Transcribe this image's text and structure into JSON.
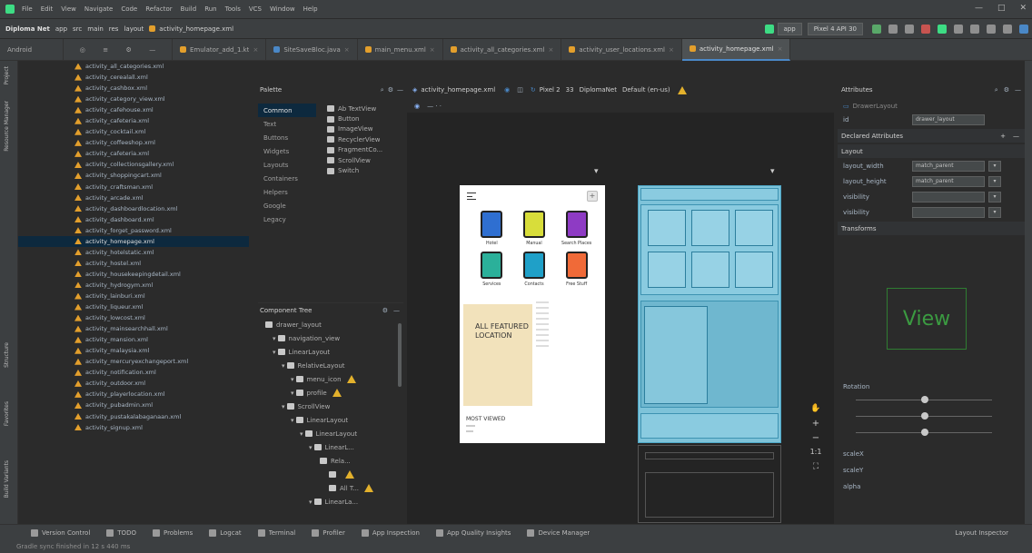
{
  "menu": {
    "items": [
      "File",
      "Edit",
      "View",
      "Navigate",
      "Code",
      "Refactor",
      "Build",
      "Run",
      "Tools",
      "VCS",
      "Window",
      "Help"
    ],
    "window_title": "",
    "controls": [
      "—",
      "□",
      "✕"
    ]
  },
  "toolbar": {
    "project": "Diploma Net",
    "path": [
      "app",
      "src",
      "main",
      "res",
      "layout",
      "activity_homepage.xml"
    ],
    "run_config": "app",
    "device": "Pixel 4 API 30"
  },
  "tabs": [
    {
      "label": "Emulator_add_1.kt",
      "icon": "xml",
      "active": false
    },
    {
      "label": "SiteSaveBloc.java",
      "icon": "java",
      "active": false
    },
    {
      "label": "main_menu.xml",
      "icon": "xml",
      "active": false
    },
    {
      "label": "activity_all_categories.xml",
      "icon": "xml",
      "active": false
    },
    {
      "label": "activity_user_locations.xml",
      "icon": "xml",
      "active": false
    },
    {
      "label": "activity_homepage.xml",
      "icon": "xml",
      "active": true
    }
  ],
  "project_panel": {
    "header": "Android",
    "files": [
      "activity_all_categories.xml",
      "activity_cerealall.xml",
      "activity_cashbox.xml",
      "activity_category_view.xml",
      "activity_cafehouse.xml",
      "activity_cafeteria.xml",
      "activity_cocktail.xml",
      "activity_coffeeshop.xml",
      "activity_cafeteria.xml",
      "activity_collectionsgallery.xml",
      "activity_shoppingcart.xml",
      "activity_craftsman.xml",
      "activity_arcade.xml",
      "activity_dashboardlocation.xml",
      "activity_dashboard.xml",
      "activity_forget_password.xml",
      "activity_homepage.xml",
      "activity_hotelstatic.xml",
      "activity_hostel.xml",
      "activity_housekeepingdetail.xml",
      "activity_hydrogym.xml",
      "activity_lainburi.xml",
      "activity_liqueur.xml",
      "activity_lowcost.xml",
      "activity_mainsearchhall.xml",
      "activity_mansion.xml",
      "activity_malaysia.xml",
      "activity_mercuryexchangeport.xml",
      "activity_notification.xml",
      "activity_outdoor.xml",
      "activity_playerlocation.xml",
      "activity_pubadmin.xml",
      "activity_pustakalabaganaan.xml",
      "activity_signup.xml"
    ],
    "selected_index": 16
  },
  "left_strip_labels": [
    "Project",
    "Resource Manager",
    "Structure",
    "Favorites",
    "Build Variants"
  ],
  "palette": {
    "title": "Palette",
    "categories": [
      "Common",
      "Text",
      "Buttons",
      "Widgets",
      "Layouts",
      "Containers",
      "Helpers",
      "Google",
      "Legacy"
    ],
    "items": [
      "Ab TextView",
      "Button",
      "ImageView",
      "RecyclerView",
      "FragmentCo...",
      "ScrollView",
      "Switch"
    ]
  },
  "component_tree": {
    "title": "Component Tree",
    "rows": [
      {
        "label": "drawer_layout",
        "indent": 0,
        "warn": false
      },
      {
        "label": "navigation_view",
        "indent": 1,
        "warn": false
      },
      {
        "label": "LinearLayout",
        "indent": 1,
        "warn": false
      },
      {
        "label": "RelativeLayout",
        "indent": 2,
        "warn": false
      },
      {
        "label": "menu_icon",
        "indent": 3,
        "warn": true
      },
      {
        "label": "profile",
        "indent": 3,
        "warn": true
      },
      {
        "label": "ScrollView",
        "indent": 2,
        "warn": false
      },
      {
        "label": "LinearLayout",
        "indent": 3,
        "warn": false
      },
      {
        "label": "LinearLayout",
        "indent": 4,
        "warn": false
      },
      {
        "label": "LinearL...",
        "indent": 5,
        "warn": false
      },
      {
        "label": "Rela...",
        "indent": 6,
        "warn": false
      },
      {
        "label": "",
        "indent": 7,
        "warn": true
      },
      {
        "label": "All T...",
        "indent": 7,
        "warn": true
      },
      {
        "label": "LinearLa...",
        "indent": 5,
        "warn": false
      }
    ]
  },
  "design_bar": {
    "file": "activity_homepage.xml",
    "device": "Pixel 2",
    "api": "33",
    "theme": "DiplomaNet",
    "locale": "Default (en-us)"
  },
  "phone": {
    "categories": [
      {
        "label": "Hotel",
        "color": "#2f6fd1"
      },
      {
        "label": "Manual",
        "color": "#d8dd3a"
      },
      {
        "label": "Search Places",
        "color": "#8e3bc4"
      },
      {
        "label": "Services",
        "color": "#2bb09a"
      },
      {
        "label": "Contacts",
        "color": "#1fa0c8"
      },
      {
        "label": "Free Stuff",
        "color": "#f06a38"
      }
    ],
    "featured_title": "ALL FEATURED LOCATION",
    "featured_sub": "",
    "most_viewed": "MOST VIEWED"
  },
  "attributes": {
    "title": "Attributes",
    "view_type": "DrawerLayout",
    "id": "drawer_layout",
    "declared_header": "Declared Attributes",
    "layout_header": "Layout",
    "rows": [
      {
        "name": "layout_width",
        "value": "match_parent"
      },
      {
        "name": "layout_height",
        "value": "match_parent"
      },
      {
        "name": "visibility",
        "value": ""
      },
      {
        "name": "visibility",
        "value": ""
      }
    ],
    "transforms_header": "Transforms",
    "view_label": "View",
    "rotation_label": "Rotation",
    "extra_rows": [
      "scaleX",
      "scaleY",
      "alpha"
    ]
  },
  "bottom": {
    "tool_windows": [
      "Version Control",
      "TODO",
      "Problems",
      "Logcat",
      "Terminal",
      "Profiler",
      "App Inspection",
      "App Quality Insights",
      "Device Manager"
    ],
    "right_tool": "Layout Inspector",
    "status": "Gradle sync finished in 12 s 440 ms"
  },
  "colors": {
    "bg": "#2b2b2b",
    "panel": "#3c3f41",
    "accent": "#4a88c7",
    "warning": "#e3b12c",
    "blueprint": "#7ec3d9"
  }
}
